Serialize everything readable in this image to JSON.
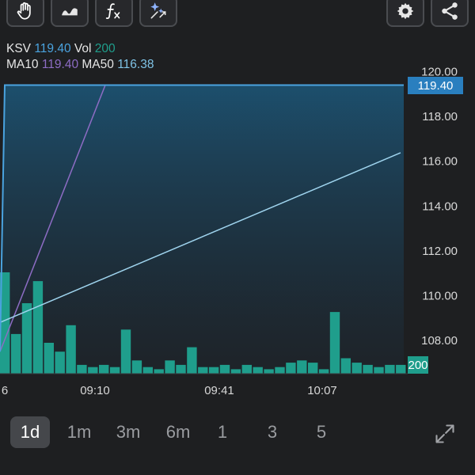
{
  "toolbar": {
    "buttons": [
      {
        "name": "hand-pan-icon"
      },
      {
        "name": "line-chart-icon"
      },
      {
        "name": "function-fx-icon"
      },
      {
        "name": "ai-sparkle-icon"
      }
    ],
    "right_buttons": [
      {
        "name": "gear-icon"
      },
      {
        "name": "share-icon"
      }
    ]
  },
  "legend": {
    "symbol": "KSV",
    "price": "119.40",
    "vol_label": "Vol",
    "volume": "200",
    "ma10_label": "MA10",
    "ma10_value": "119.40",
    "ma50_label": "MA50",
    "ma50_value": "116.38"
  },
  "colors": {
    "price": "#4aa3df",
    "volume": "#1f9e8c",
    "ma10": "#8d6cc4",
    "ma50": "#9fd4ee",
    "background": "#1e1f21"
  },
  "chart_data": {
    "type": "line",
    "price_axis": {
      "ticks": [
        "120.00",
        "118.00",
        "116.00",
        "114.00",
        "112.00",
        "110.00",
        "108.00"
      ],
      "tick_values": [
        120,
        118,
        116,
        114,
        112,
        110,
        108
      ],
      "current_price_label": "119.40",
      "current_price": 119.4
    },
    "volume_axis": {
      "current_volume_label": "200",
      "current_volume": 200
    },
    "time_axis": {
      "ticks": [
        "6",
        "09:10",
        "09:41",
        "10:07"
      ]
    },
    "price_series": {
      "name": "KSV",
      "values": [
        107.5,
        119.4,
        119.4
      ]
    },
    "ma10": {
      "name": "MA10",
      "from": 107.5,
      "to": 119.4
    },
    "ma50": {
      "name": "MA50",
      "from": 108.8,
      "to": 116.38
    },
    "volume_series": {
      "name": "Vol",
      "values": [
        2300,
        900,
        1600,
        2100,
        700,
        500,
        1100,
        200,
        150,
        200,
        150,
        1000,
        300,
        150,
        100,
        300,
        200,
        600,
        150,
        150,
        200,
        100,
        200,
        150,
        100,
        150,
        250,
        300,
        250,
        100,
        1400,
        350,
        250,
        200,
        150,
        200,
        200
      ]
    }
  },
  "bottom": {
    "ranges": [
      {
        "label": "1d",
        "active": true
      },
      {
        "label": "1m",
        "active": false
      },
      {
        "label": "3m",
        "active": false
      },
      {
        "label": "6m",
        "active": false
      },
      {
        "label": "1",
        "active": false
      },
      {
        "label": "3",
        "active": false
      },
      {
        "label": "5",
        "active": false
      }
    ]
  }
}
